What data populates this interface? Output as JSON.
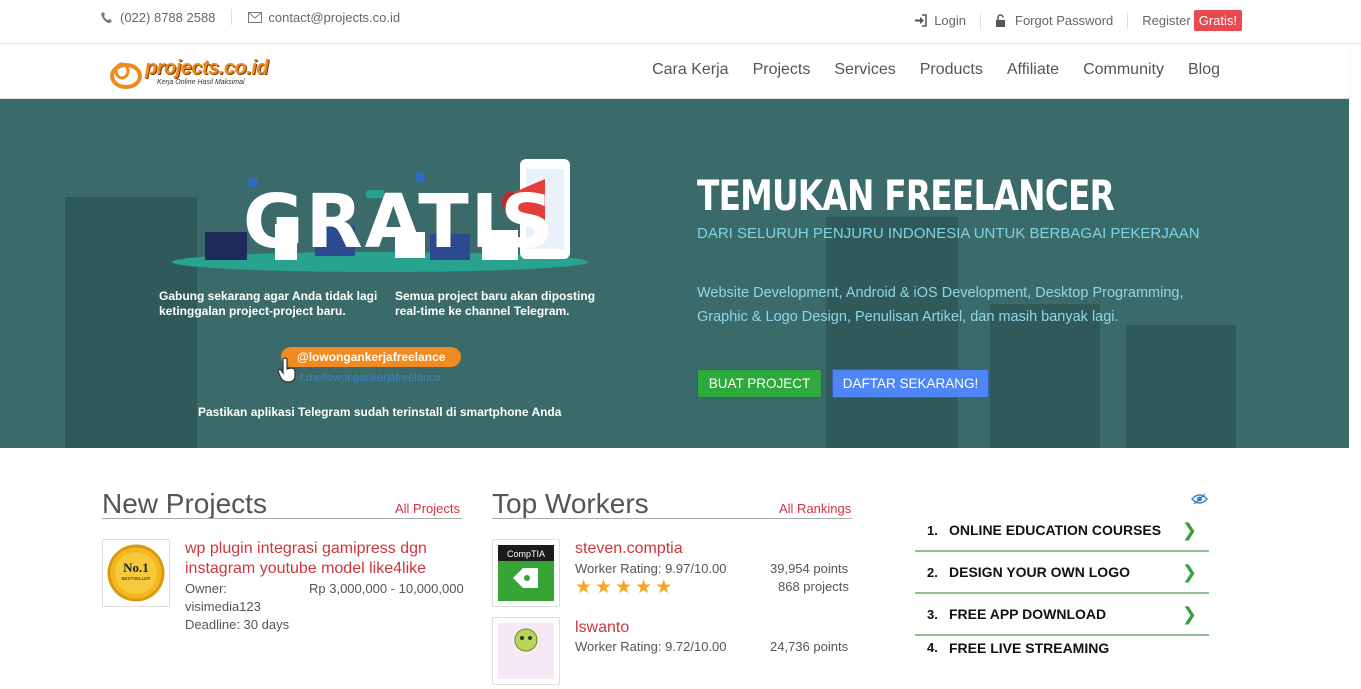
{
  "topbar": {
    "phone": "(022) 8788 2588",
    "email": "contact@projects.co.id",
    "login": "Login",
    "forgot": "Forgot Password",
    "register": "Register",
    "register_badge": "Gratis!"
  },
  "logo": {
    "text": "projects.co.id",
    "tagline": "Kerja Online Hasil Maksimal"
  },
  "nav": [
    "Cara Kerja",
    "Projects",
    "Services",
    "Products",
    "Affiliate",
    "Community",
    "Blog"
  ],
  "hero": {
    "title": "TEMUKAN FREELANCER",
    "subtitle": "DARI SELURUH PENJURU INDONESIA UNTUK BERBAGAI PEKERJAAN",
    "description": "Website Development, Android & iOS Development, Desktop Programming, Graphic & Logo Design, Penulisan Artikel, dan masih banyak lagi.",
    "btn_primary": "BUAT PROJECT",
    "btn_secondary": "DAFTAR SEKARANG!",
    "promo": {
      "word": "GRATIS",
      "note_left": "Gabung sekarang agar Anda tidak lagi ketinggalan project-project baru.",
      "note_right": "Semua project baru akan diposting real-time ke channel Telegram.",
      "telegram_handle": "@lowongankerjafreelance",
      "telegram_link": "t.me/lowongankerjafreelance",
      "footer": "Pastikan aplikasi Telegram sudah terinstall di smartphone Anda"
    }
  },
  "new_projects": {
    "title": "New Projects",
    "link": "All Projects",
    "items": [
      {
        "thumb_label": "No.1",
        "thumb_sub": "BESTSELLER",
        "title": "wp plugin integrasi gamipress dgn instagram youtube model like4like",
        "owner_label": "Owner:",
        "owner": "visimedia123",
        "budget": "Rp 3,000,000 - 10,000,000",
        "deadline": "Deadline: 30 days"
      }
    ]
  },
  "top_workers": {
    "title": "Top Workers",
    "link": "All Rankings",
    "items": [
      {
        "name": "steven.comptia",
        "rating": "Worker Rating: 9.97/10.00",
        "points": "39,954 points",
        "projects": "868 projects",
        "stars": 5,
        "avatar": "CompTIA"
      },
      {
        "name": "lswanto",
        "rating": "Worker Rating: 9.72/10.00",
        "points": "24,736 points"
      }
    ]
  },
  "ranked_list": [
    {
      "num": "1.",
      "label": "ONLINE EDUCATION COURSES"
    },
    {
      "num": "2.",
      "label": "DESIGN YOUR OWN LOGO"
    },
    {
      "num": "3.",
      "label": "FREE APP DOWNLOAD"
    },
    {
      "num": "4.",
      "label": "FREE LIVE STREAMING"
    }
  ],
  "colors": {
    "accent_red": "#d0353f",
    "hero_bg": "#3b6a6a",
    "green_btn": "#2eaa3c",
    "blue_btn": "#4f86f7",
    "orange": "#f18a1f"
  }
}
